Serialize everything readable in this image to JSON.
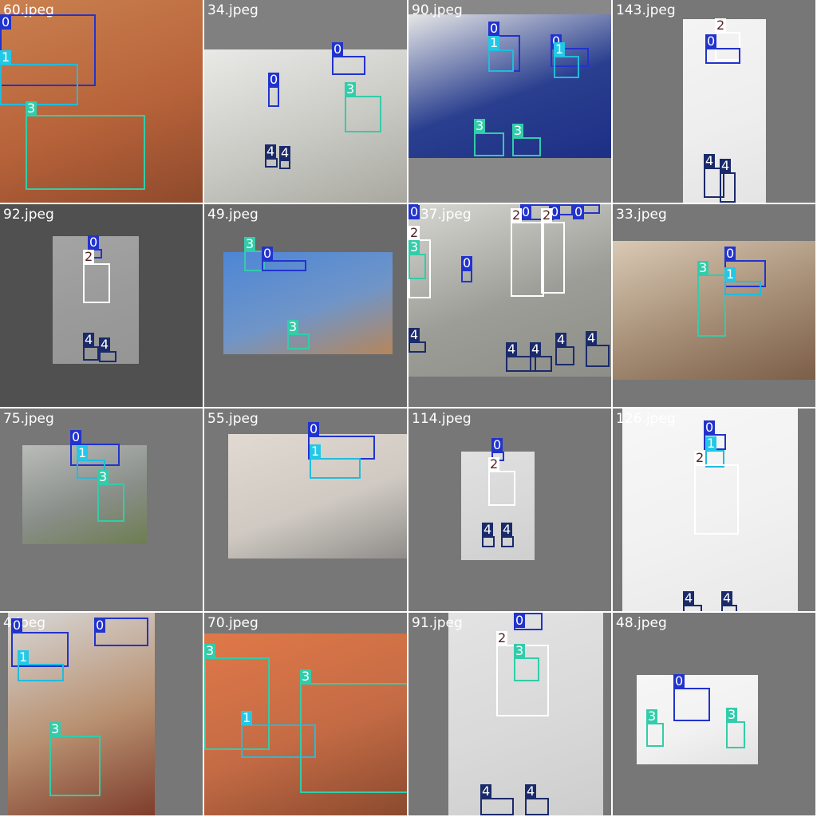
{
  "classes": {
    "0": {
      "text": "0",
      "box": "#2233cc",
      "tag": "#2233cc",
      "fg": "#ffffff"
    },
    "1": {
      "text": "1",
      "box": "#22bbdd",
      "tag": "#22c8e6",
      "fg": "#ffffff"
    },
    "2": {
      "text": "2",
      "box": "#ffffff",
      "tag": "#ffffff",
      "fg": "#552222"
    },
    "3": {
      "text": "3",
      "box": "#33ccaa",
      "tag": "#33ccaa",
      "fg": "#ffffff"
    },
    "4": {
      "text": "4",
      "box": "#1a2a6a",
      "tag": "#1a2a6a",
      "fg": "#ffffff"
    }
  },
  "tiles": [
    {
      "name": "60.jpeg",
      "bg": "#777777",
      "photo": {
        "color": "#b8633a",
        "gradient": [
          "#c9804f",
          "#8e4a2c"
        ]
      },
      "boxes": [
        {
          "c": "0"
        },
        {
          "c": "1"
        },
        {
          "c": "3"
        }
      ]
    },
    {
      "name": "34.jpeg",
      "bg": "#808080",
      "photo": {
        "color": "#c9c9c4",
        "gradient": [
          "#e9e9e6",
          "#a8a8a0"
        ]
      },
      "boxes": [
        {
          "c": "0"
        },
        {
          "c": "0"
        },
        {
          "c": "3"
        },
        {
          "c": "4"
        },
        {
          "c": "4"
        }
      ]
    },
    {
      "name": "90.jpeg",
      "bg": "#888888",
      "photo": {
        "color": "#2a3f8f",
        "gradient": [
          "#e6e6e6",
          "#1d2f86"
        ]
      },
      "boxes": [
        {
          "c": "0"
        },
        {
          "c": "0"
        },
        {
          "c": "1"
        },
        {
          "c": "1"
        },
        {
          "c": "3"
        },
        {
          "c": "3"
        }
      ]
    },
    {
      "name": "143.jpeg",
      "bg": "#777777",
      "photo": {
        "color": "#eeeeee",
        "gradient": [
          "#f4f4f4",
          "#e4e4e4"
        ]
      },
      "boxes": [
        {
          "c": "2"
        },
        {
          "c": "0"
        },
        {
          "c": "4"
        },
        {
          "c": "4"
        }
      ]
    },
    {
      "name": "92.jpeg",
      "bg": "#505050",
      "photo": {
        "color": "#9a9a9a",
        "gradient": [
          "#a4a4a4",
          "#959595"
        ]
      },
      "boxes": [
        {
          "c": "0"
        },
        {
          "c": "2"
        },
        {
          "c": "4"
        },
        {
          "c": "4"
        }
      ]
    },
    {
      "name": "49.jpeg",
      "bg": "#6a6a6a",
      "photo": {
        "color": "#6f95c8",
        "gradient": [
          "#4d86d6",
          "#b6865a"
        ]
      },
      "boxes": [
        {
          "c": "3"
        },
        {
          "c": "0"
        },
        {
          "c": "3"
        }
      ]
    },
    {
      "name": "137.jpeg",
      "bg": "#777777",
      "photo": {
        "color": "#9d9d98",
        "gradient": [
          "#d7d7d2",
          "#8e8e88"
        ]
      },
      "boxes": [
        {
          "c": "0"
        },
        {
          "c": "2"
        },
        {
          "c": "3"
        },
        {
          "c": "0"
        },
        {
          "c": "0"
        },
        {
          "c": "2"
        },
        {
          "c": "0"
        },
        {
          "c": "2"
        },
        {
          "c": "0"
        },
        {
          "c": "4"
        },
        {
          "c": "4"
        },
        {
          "c": "4"
        },
        {
          "c": "4"
        },
        {
          "c": "4"
        }
      ]
    },
    {
      "name": "33.jpeg",
      "bg": "#777777",
      "photo": {
        "color": "#a48c74",
        "gradient": [
          "#d9c9b4",
          "#7c5e48"
        ]
      },
      "boxes": [
        {
          "c": "0"
        },
        {
          "c": "3"
        },
        {
          "c": "1"
        }
      ]
    },
    {
      "name": "75.jpeg",
      "bg": "#777777",
      "photo": {
        "color": "#8a8f8a",
        "gradient": [
          "#b9bcb9",
          "#6e7d52"
        ]
      },
      "boxes": [
        {
          "c": "0"
        },
        {
          "c": "1"
        },
        {
          "c": "3"
        }
      ]
    },
    {
      "name": "55.jpeg",
      "bg": "#777777",
      "photo": {
        "color": "#cfc9c2",
        "gradient": [
          "#e0dad2",
          "#8f8d8a"
        ]
      },
      "boxes": [
        {
          "c": "0"
        },
        {
          "c": "1"
        }
      ]
    },
    {
      "name": "114.jpeg",
      "bg": "#777777",
      "photo": {
        "color": "#d8d8d8",
        "gradient": [
          "#e0e0e0",
          "#cfcfcf"
        ]
      },
      "boxes": [
        {
          "c": "0"
        },
        {
          "c": "2"
        },
        {
          "c": "4"
        },
        {
          "c": "4"
        }
      ]
    },
    {
      "name": "126.jpeg",
      "bg": "#777777",
      "photo": {
        "color": "#f1f1f1",
        "gradient": [
          "#f7f7f7",
          "#e8e8e8"
        ]
      },
      "boxes": [
        {
          "c": "0"
        },
        {
          "c": "1"
        },
        {
          "c": "2"
        },
        {
          "c": "4"
        },
        {
          "c": "4"
        }
      ]
    },
    {
      "name": "4.jpeg",
      "bg": "#777777",
      "photo": {
        "color": "#b89070",
        "gradient": [
          "#d7d7d7",
          "#7e3d2c"
        ]
      },
      "boxes": [
        {
          "c": "0"
        },
        {
          "c": "0"
        },
        {
          "c": "1"
        },
        {
          "c": "3"
        }
      ]
    },
    {
      "name": "70.jpeg",
      "bg": "#777777",
      "photo": {
        "color": "#c46b45",
        "gradient": [
          "#e07848",
          "#8a4a2e"
        ]
      },
      "boxes": [
        {
          "c": "3"
        },
        {
          "c": "3"
        },
        {
          "c": "1"
        }
      ]
    },
    {
      "name": "91.jpeg",
      "bg": "#777777",
      "photo": {
        "color": "#d9d9d9",
        "gradient": [
          "#e3e3e3",
          "#cdcdcd"
        ]
      },
      "boxes": [
        {
          "c": "0"
        },
        {
          "c": "2"
        },
        {
          "c": "3"
        },
        {
          "c": "4"
        },
        {
          "c": "4"
        }
      ]
    },
    {
      "name": "48.jpeg",
      "bg": "#777777",
      "photo": {
        "color": "#f2f2f2",
        "gradient": [
          "#f6f6f6",
          "#e2e2e2"
        ]
      },
      "boxes": [
        {
          "c": "0"
        },
        {
          "c": "3"
        },
        {
          "c": "3"
        }
      ]
    }
  ]
}
